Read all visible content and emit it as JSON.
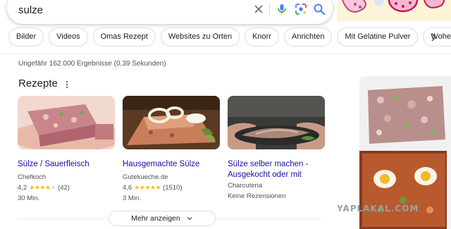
{
  "search": {
    "query": "sulze"
  },
  "chips": [
    "Bilder",
    "Videos",
    "Omas Rezept",
    "Websites zu Orten",
    "Knorr",
    "Anrichten",
    "Mit Gelatine Pulver",
    "Woher kommt"
  ],
  "result_stats": "Ungefähr 162.000 Ergebnisse (0,39 Sekunden)",
  "section_title": "Rezepte",
  "recipes": [
    {
      "title": "Sülze / Sauerfleisch",
      "source": "Chefkoch",
      "rating": "4,2",
      "stars": 4.2,
      "count": "(42)",
      "time": "30 Min."
    },
    {
      "title": "Hausgemachte Sülze",
      "source": "Gutekueche.de",
      "rating": "4,6",
      "stars": 4.6,
      "count": "(1510)",
      "time": "3 Min."
    },
    {
      "title": "Sülze selber machen - Ausgekocht oder mit Aspi…",
      "source": "Charcuteria",
      "reviews": "Keine Rezensionen"
    }
  ],
  "more_button": "Mehr anzeigen",
  "watermark": "YAPLAKAL.COM",
  "colors": {
    "link": "#1a0dab",
    "star": "#fbbc04",
    "border": "#dadce0"
  }
}
